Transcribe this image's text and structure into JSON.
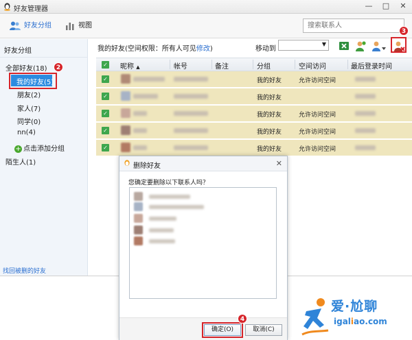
{
  "window": {
    "title": "好友管理器",
    "minimize": "—",
    "maximize": "□",
    "close": "✕"
  },
  "toolbar": {
    "group_tab": "好友分组",
    "view_tab": "视图",
    "search_placeholder": "搜索联系人"
  },
  "sidebar": {
    "header": "好友分组",
    "all_friends": "全部好友(18)",
    "groups": [
      "我的好友(5)",
      "朋友(2)",
      "家人(7)",
      "同学(0)",
      "nn(4)"
    ],
    "add_group": "点击添加分组",
    "strangers": "陌生人(1)",
    "recover_link": "找回被删的好友"
  },
  "main": {
    "info_prefix": "我的好友(空间权限：所有人可见",
    "info_link": "修改",
    "info_suffix": ")",
    "move_to_label": "移动到",
    "move_to_value": "",
    "columns": [
      "昵称",
      "帐号",
      "备注",
      "分组",
      "空间访问",
      "最后登录时间"
    ],
    "sort_indicator": "▲",
    "rows": [
      {
        "group": "我的好友",
        "access": "允许访问空间"
      },
      {
        "group": "我的好友",
        "access": ""
      },
      {
        "group": "我的好友",
        "access": "允许访问空间"
      },
      {
        "group": "我的好友",
        "access": "允许访问空间"
      },
      {
        "group": "我的好友",
        "access": "允许访问空间"
      }
    ]
  },
  "dialog": {
    "title": "删除好友",
    "question": "您确定要删除以下联系人吗？",
    "confirm": "确定(O)",
    "cancel": "取消(C)",
    "avatar_colors": [
      "#b8a8a0",
      "#a7b3c6",
      "#c8a79a",
      "#9e7f74",
      "#b27a63",
      "#c7935f"
    ]
  },
  "annotations": {
    "badge_2": "2",
    "badge_3": "3",
    "badge_4": "4",
    "color": "#d6242a"
  },
  "watermark": {
    "top": "爱·尬聊",
    "bottom_pre": "igal",
    "bottom_o": "i",
    "bottom_post": "ao.com"
  },
  "colors": {
    "selected_bg": "#2c8be0",
    "row_bg": "#efe6bd",
    "check": "#3ea64d",
    "link": "#2b6fd0"
  }
}
